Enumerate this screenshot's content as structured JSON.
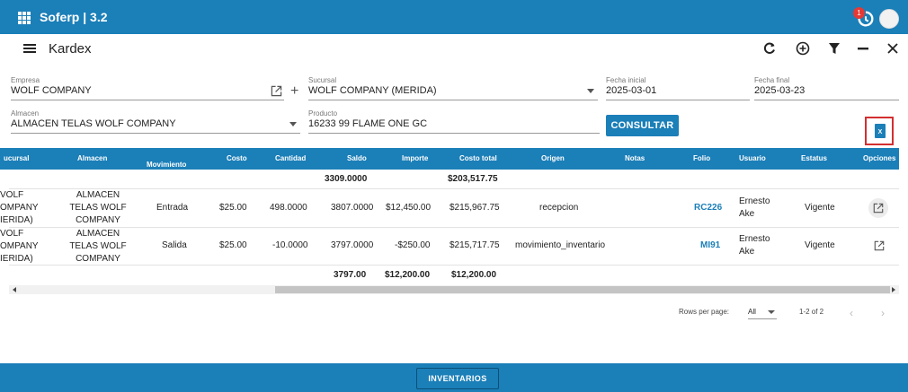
{
  "app": {
    "brand": "Soferp | 3.2",
    "notification_count": "1",
    "accent": "#1b7fb8"
  },
  "titlebar": {
    "title": "Kardex"
  },
  "form": {
    "empresa": {
      "label": "Empresa",
      "value": "WOLF COMPANY"
    },
    "sucursal": {
      "label": "Sucursal",
      "value": "WOLF COMPANY (MERIDA)"
    },
    "fecha_inicial": {
      "label": "Fecha inicial",
      "value": "2025-03-01"
    },
    "fecha_final": {
      "label": "Fecha final",
      "value": "2025-03-23"
    },
    "almacen": {
      "label": "Almacen",
      "value": "ALMACEN TELAS WOLF COMPANY"
    },
    "producto": {
      "label": "Producto",
      "value": "16233 99 FLAME ONE GC"
    },
    "consultar_label": "CONSULTAR"
  },
  "table": {
    "headers": [
      "ucursal",
      "Almacen",
      "Movimiento",
      "Costo",
      "Cantidad",
      "Saldo",
      "Importe",
      "Costo total",
      "Origen",
      "Notas",
      "Folio",
      "Usuario",
      "Estatus",
      "Opciones"
    ],
    "opening": {
      "saldo": "3309.0000",
      "costo_total": "$203,517.75"
    },
    "rows": [
      {
        "sucursal": [
          "VOLF",
          "OMPANY",
          "IERIDA)"
        ],
        "almacen": [
          "ALMACEN",
          "TELAS WOLF",
          "COMPANY"
        ],
        "movimiento": "Entrada",
        "costo": "$25.00",
        "cantidad": "498.0000",
        "saldo": "3807.0000",
        "importe": "$12,450.00",
        "costo_total": "$215,967.75",
        "origen": "recepcion",
        "notas": "",
        "folio": "RC226",
        "usuario": [
          "Ernesto",
          "Ake"
        ],
        "estatus": "Vigente"
      },
      {
        "sucursal": [
          "VOLF",
          "OMPANY",
          "IERIDA)"
        ],
        "almacen": [
          "ALMACEN",
          "TELAS WOLF",
          "COMPANY"
        ],
        "movimiento": "Salida",
        "costo": "$25.00",
        "cantidad": "-10.0000",
        "saldo": "3797.0000",
        "importe": "-$250.00",
        "costo_total": "$215,717.75",
        "origen": "movimiento_inventario",
        "notas": "",
        "folio": "MI91",
        "usuario": [
          "Ernesto",
          "Ake"
        ],
        "estatus": "Vigente"
      }
    ],
    "totals": {
      "saldo": "3797.00",
      "importe": "$12,200.00",
      "costo_total": "$12,200.00"
    }
  },
  "pagination": {
    "rows_per_page_label": "Rows per page:",
    "rows_per_page_value": "All",
    "range": "1-2 of 2"
  },
  "footer": {
    "button_label": "INVENTARIOS"
  }
}
